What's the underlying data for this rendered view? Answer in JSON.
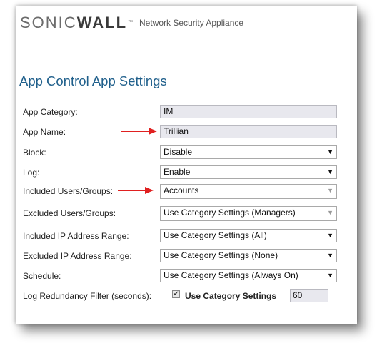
{
  "header": {
    "logo_sonic": "SONIC",
    "logo_wall": "WALL",
    "logo_tm": "™",
    "product": "Network Security Appliance"
  },
  "page_title": "App Control App Settings",
  "form": {
    "app_category": {
      "label": "App Category:",
      "value": "IM"
    },
    "app_name": {
      "label": "App Name:",
      "value": "Trillian"
    },
    "block": {
      "label": "Block:",
      "value": "Disable"
    },
    "log": {
      "label": "Log:",
      "value": "Enable"
    },
    "included_users": {
      "label": "Included Users/Groups:",
      "value": "Accounts"
    },
    "excluded_users": {
      "label": "Excluded Users/Groups:",
      "value": "Use Category Settings (Managers)"
    },
    "included_ip": {
      "label": "Included IP Address Range:",
      "value": "Use Category Settings (All)"
    },
    "excluded_ip": {
      "label": "Excluded IP Address Range:",
      "value": "Use Category Settings (None)"
    },
    "schedule": {
      "label": "Schedule:",
      "value": "Use Category Settings (Always On)"
    },
    "log_redundancy": {
      "label": "Log Redundancy Filter (seconds):",
      "checkbox_label": "Use Category Settings",
      "checked": true,
      "value": "60"
    }
  },
  "icons": {
    "dropdown": "▼",
    "check": "✔"
  },
  "colors": {
    "title": "#1f5f8b",
    "annotation_arrow": "#e02020"
  }
}
